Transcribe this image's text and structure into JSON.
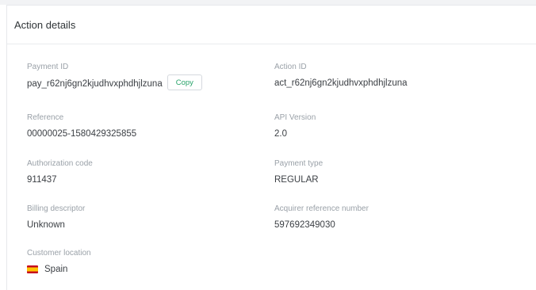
{
  "card": {
    "title": "Action details"
  },
  "fields": {
    "payment_id": {
      "label": "Payment ID",
      "value": "pay_r62nj6gn2kjudhvxphdhjlzuna"
    },
    "action_id": {
      "label": "Action ID",
      "value": "act_r62nj6gn2kjudhvxphdhjlzuna"
    },
    "reference": {
      "label": "Reference",
      "value": "00000025-1580429325855"
    },
    "api_version": {
      "label": "API Version",
      "value": "2.0"
    },
    "authorization_code": {
      "label": "Authorization code",
      "value": "911437"
    },
    "payment_type": {
      "label": "Payment type",
      "value": "REGULAR"
    },
    "billing_descriptor": {
      "label": "Billing descriptor",
      "value": "Unknown"
    },
    "acquirer_reference_number": {
      "label": "Acquirer reference number",
      "value": "597692349030"
    },
    "customer_location": {
      "label": "Customer location",
      "value": "Spain",
      "flag_icon": "spain-flag-icon"
    }
  },
  "actions": {
    "copy_label": "Copy"
  },
  "colors": {
    "copy_text": "#26a269",
    "label_text": "#9aa1a8",
    "value_text": "#3b3f44"
  }
}
